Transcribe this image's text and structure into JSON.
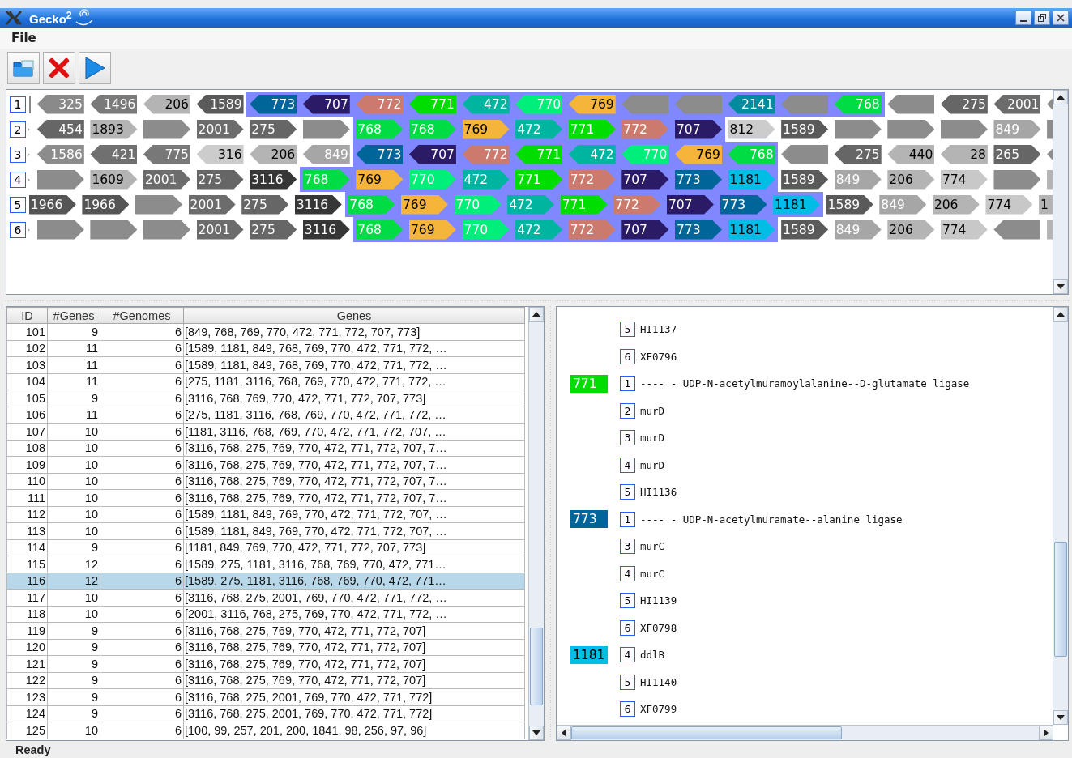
{
  "window": {
    "title": "Gecko$^{2}$"
  },
  "menu": [
    "File"
  ],
  "gene_rows": [
    {
      "number": "1",
      "kind": "bar",
      "genes": [
        {
          "label": "325",
          "color": "#8a8a8a",
          "dark_label": false,
          "kind": "reverse",
          "highlighted": false
        },
        {
          "label": "1496",
          "color": "#7a7a7a",
          "dark_label": false,
          "kind": "reverse",
          "highlighted": false
        },
        {
          "label": "206",
          "color": "#b4b4b4",
          "dark_label": true,
          "kind": "reverse",
          "highlighted": false
        },
        {
          "label": "1589",
          "color": "#5a5a5a",
          "dark_label": false,
          "kind": "reverse",
          "highlighted": false
        },
        {
          "label": "773",
          "color": "#006699",
          "dark_label": false,
          "kind": "reverse",
          "highlighted": true
        },
        {
          "label": "707",
          "color": "#2b1a66",
          "dark_label": false,
          "kind": "reverse",
          "highlighted": true
        },
        {
          "label": "772",
          "color": "#cc7a6e",
          "dark_label": false,
          "kind": "reverse",
          "highlighted": true
        },
        {
          "label": "771",
          "color": "#00dd00",
          "dark_label": false,
          "kind": "reverse",
          "highlighted": true
        },
        {
          "label": "472",
          "color": "#00b5a0",
          "dark_label": false,
          "kind": "reverse",
          "highlighted": true
        },
        {
          "label": "770",
          "color": "#00ee7a",
          "dark_label": false,
          "kind": "reverse",
          "highlighted": true
        },
        {
          "label": "769",
          "color": "#f5b53a",
          "dark_label": true,
          "kind": "reverse",
          "highlighted": true
        },
        {
          "color": "#8c8c8c",
          "kind": "reverse",
          "highlighted": true
        },
        {
          "color": "#8c8c8c",
          "kind": "reverse",
          "highlighted": true
        },
        {
          "label": "2141",
          "color": "#008b9e",
          "dark_label": false,
          "kind": "reverse",
          "highlighted": true
        },
        {
          "color": "#8c8c8c",
          "kind": "reverse",
          "highlighted": true
        },
        {
          "label": "768",
          "color": "#00dd44",
          "dark_label": false,
          "kind": "reverse",
          "highlighted": true
        },
        {
          "color": "#8c8c8c",
          "kind": "reverse",
          "highlighted": false
        },
        {
          "label": "275",
          "color": "#666666",
          "dark_label": false,
          "kind": "reverse",
          "highlighted": false
        },
        {
          "label": "2001",
          "color": "#6c6c6c",
          "dark_label": false,
          "kind": "reverse",
          "highlighted": false
        },
        {
          "color": "#8c8c8c",
          "kind": "reverse",
          "highlighted": false
        }
      ]
    },
    {
      "number": "2",
      "kind": "dot",
      "genes": [
        {
          "label": "454",
          "color": "#666666",
          "dark_label": false,
          "kind": "reverse",
          "highlighted": false
        },
        {
          "label": "1893",
          "color": "#b4b4b4",
          "dark_label": true,
          "kind": "forward",
          "highlighted": false
        },
        {
          "color": "#8c8c8c",
          "kind": "forward",
          "highlighted": false
        },
        {
          "label": "2001",
          "color": "#6c6c6c",
          "dark_label": false,
          "kind": "forward",
          "highlighted": false
        },
        {
          "label": "275",
          "color": "#666666",
          "dark_label": false,
          "kind": "forward",
          "highlighted": false
        },
        {
          "color": "#8c8c8c",
          "kind": "forward",
          "highlighted": false
        },
        {
          "label": "768",
          "color": "#00dd44",
          "dark_label": false,
          "kind": "forward",
          "highlighted": true
        },
        {
          "label": "768",
          "color": "#00dd44",
          "dark_label": false,
          "kind": "forward",
          "highlighted": true
        },
        {
          "label": "769",
          "color": "#f5b53a",
          "dark_label": true,
          "kind": "forward",
          "highlighted": true
        },
        {
          "label": "472",
          "color": "#00b5a0",
          "dark_label": false,
          "kind": "forward",
          "highlighted": true
        },
        {
          "label": "771",
          "color": "#00dd00",
          "dark_label": false,
          "kind": "forward",
          "highlighted": true
        },
        {
          "label": "772",
          "color": "#cc7a6e",
          "dark_label": false,
          "kind": "forward",
          "highlighted": true
        },
        {
          "label": "707",
          "color": "#2b1a66",
          "dark_label": false,
          "kind": "forward",
          "highlighted": true
        },
        {
          "label": "812",
          "color": "#cccccc",
          "dark_label": true,
          "kind": "forward",
          "highlighted": false
        },
        {
          "label": "1589",
          "color": "#5a5a5a",
          "dark_label": false,
          "kind": "forward",
          "highlighted": false
        },
        {
          "color": "#8c8c8c",
          "kind": "forward",
          "highlighted": false
        },
        {
          "color": "#8c8c8c",
          "kind": "forward",
          "highlighted": false
        },
        {
          "color": "#8c8c8c",
          "kind": "forward",
          "highlighted": false
        },
        {
          "label": "849",
          "color": "#a6a6a6",
          "dark_label": false,
          "kind": "forward",
          "highlighted": false
        },
        {
          "color": "#8c8c8c",
          "kind": "forward",
          "highlighted": false
        }
      ]
    },
    {
      "number": "3",
      "kind": "dot",
      "genes": [
        {
          "label": "1586",
          "color": "#8c8c8c",
          "dark_label": false,
          "kind": "reverse",
          "highlighted": false
        },
        {
          "label": "421",
          "color": "#707070",
          "dark_label": false,
          "kind": "reverse",
          "highlighted": false
        },
        {
          "label": "775",
          "color": "#787878",
          "dark_label": false,
          "kind": "reverse",
          "highlighted": false
        },
        {
          "label": "316",
          "color": "#cccccc",
          "dark_label": true,
          "kind": "reverse",
          "highlighted": false
        },
        {
          "label": "206",
          "color": "#b4b4b4",
          "dark_label": true,
          "kind": "reverse",
          "highlighted": false
        },
        {
          "label": "849",
          "color": "#a6a6a6",
          "dark_label": false,
          "kind": "reverse",
          "highlighted": false
        },
        {
          "label": "773",
          "color": "#006699",
          "dark_label": false,
          "kind": "reverse",
          "highlighted": true
        },
        {
          "label": "707",
          "color": "#2b1a66",
          "dark_label": false,
          "kind": "reverse",
          "highlighted": true
        },
        {
          "label": "772",
          "color": "#cc7a6e",
          "dark_label": false,
          "kind": "reverse",
          "highlighted": true
        },
        {
          "label": "771",
          "color": "#00dd00",
          "dark_label": false,
          "kind": "reverse",
          "highlighted": true
        },
        {
          "label": "472",
          "color": "#00b5a0",
          "dark_label": false,
          "kind": "reverse",
          "highlighted": true
        },
        {
          "label": "770",
          "color": "#00ee7a",
          "dark_label": false,
          "kind": "reverse",
          "highlighted": true
        },
        {
          "label": "769",
          "color": "#f5b53a",
          "dark_label": true,
          "kind": "reverse",
          "highlighted": true
        },
        {
          "label": "768",
          "color": "#00dd44",
          "dark_label": false,
          "kind": "reverse",
          "highlighted": true
        },
        {
          "color": "#8c8c8c",
          "kind": "reverse",
          "highlighted": false
        },
        {
          "label": "275",
          "color": "#666666",
          "dark_label": false,
          "kind": "reverse",
          "highlighted": false
        },
        {
          "label": "440",
          "color": "#b4b4b4",
          "dark_label": true,
          "kind": "reverse",
          "highlighted": false
        },
        {
          "label": "28",
          "color": "#b4b4b4",
          "dark_label": true,
          "kind": "reverse",
          "highlighted": false
        },
        {
          "label": "265",
          "color": "#666666",
          "dark_label": false,
          "kind": "forward",
          "highlighted": false
        },
        {
          "color": "#8c8c8c",
          "kind": "reverse",
          "highlighted": false
        }
      ]
    },
    {
      "number": "4",
      "kind": "dot",
      "genes": [
        {
          "color": "#8c8c8c",
          "kind": "forward",
          "highlighted": false
        },
        {
          "label": "1609",
          "color": "#b4b4b4",
          "dark_label": true,
          "kind": "forward",
          "highlighted": false
        },
        {
          "label": "2001",
          "color": "#6c6c6c",
          "dark_label": false,
          "kind": "forward",
          "highlighted": false
        },
        {
          "label": "275",
          "color": "#666666",
          "dark_label": false,
          "kind": "forward",
          "highlighted": false
        },
        {
          "label": "3116",
          "color": "#363636",
          "dark_label": false,
          "kind": "forward",
          "highlighted": false
        },
        {
          "label": "768",
          "color": "#00dd44",
          "dark_label": false,
          "kind": "forward",
          "highlighted": true
        },
        {
          "label": "769",
          "color": "#f5b53a",
          "dark_label": true,
          "kind": "forward",
          "highlighted": true
        },
        {
          "label": "770",
          "color": "#00ee7a",
          "dark_label": false,
          "kind": "forward",
          "highlighted": true
        },
        {
          "label": "472",
          "color": "#00b5a0",
          "dark_label": false,
          "kind": "forward",
          "highlighted": true
        },
        {
          "label": "771",
          "color": "#00dd00",
          "dark_label": false,
          "kind": "forward",
          "highlighted": true
        },
        {
          "label": "772",
          "color": "#cc7a6e",
          "dark_label": false,
          "kind": "forward",
          "highlighted": true
        },
        {
          "label": "707",
          "color": "#2b1a66",
          "dark_label": false,
          "kind": "forward",
          "highlighted": true
        },
        {
          "label": "773",
          "color": "#006699",
          "dark_label": false,
          "kind": "forward",
          "highlighted": true
        },
        {
          "label": "1181",
          "color": "#00bde6",
          "dark_label": true,
          "kind": "forward",
          "highlighted": true
        },
        {
          "label": "1589",
          "color": "#5a5a5a",
          "dark_label": false,
          "kind": "forward",
          "highlighted": false
        },
        {
          "label": "849",
          "color": "#a6a6a6",
          "dark_label": false,
          "kind": "forward",
          "highlighted": false
        },
        {
          "label": "206",
          "color": "#b4b4b4",
          "dark_label": true,
          "kind": "forward",
          "highlighted": false
        },
        {
          "label": "774",
          "color": "#c8c8c8",
          "dark_label": true,
          "kind": "forward",
          "highlighted": false
        },
        {
          "color": "#8c8c8c",
          "kind": "forward",
          "highlighted": false
        },
        {
          "color": "#b4b4b4",
          "kind": "forward",
          "highlighted": false
        }
      ]
    },
    {
      "number": "5",
      "kind": "none",
      "genes": [
        {
          "label": "1966",
          "color": "#555555",
          "dark_label": false,
          "kind": "forward",
          "highlighted": false
        },
        {
          "label": "1966",
          "color": "#555555",
          "dark_label": false,
          "kind": "forward",
          "highlighted": false
        },
        {
          "color": "#8c8c8c",
          "kind": "forward",
          "highlighted": false
        },
        {
          "label": "2001",
          "color": "#6c6c6c",
          "dark_label": false,
          "kind": "forward",
          "highlighted": false
        },
        {
          "label": "275",
          "color": "#666666",
          "dark_label": false,
          "kind": "forward",
          "highlighted": false
        },
        {
          "label": "3116",
          "color": "#363636",
          "dark_label": false,
          "kind": "forward",
          "highlighted": false
        },
        {
          "label": "768",
          "color": "#00dd44",
          "dark_label": false,
          "kind": "forward",
          "highlighted": true
        },
        {
          "label": "769",
          "color": "#f5b53a",
          "dark_label": true,
          "kind": "forward",
          "highlighted": true
        },
        {
          "label": "770",
          "color": "#00ee7a",
          "dark_label": false,
          "kind": "forward",
          "highlighted": true
        },
        {
          "label": "472",
          "color": "#00b5a0",
          "dark_label": false,
          "kind": "forward",
          "highlighted": true
        },
        {
          "label": "771",
          "color": "#00dd00",
          "dark_label": false,
          "kind": "forward",
          "highlighted": true
        },
        {
          "label": "772",
          "color": "#cc7a6e",
          "dark_label": false,
          "kind": "forward",
          "highlighted": true
        },
        {
          "label": "707",
          "color": "#2b1a66",
          "dark_label": false,
          "kind": "forward",
          "highlighted": true
        },
        {
          "label": "773",
          "color": "#006699",
          "dark_label": false,
          "kind": "forward",
          "highlighted": true
        },
        {
          "label": "1181",
          "color": "#00bde6",
          "dark_label": true,
          "kind": "forward",
          "highlighted": true
        },
        {
          "label": "1589",
          "color": "#5a5a5a",
          "dark_label": false,
          "kind": "forward",
          "highlighted": false
        },
        {
          "label": "849",
          "color": "#a6a6a6",
          "dark_label": false,
          "kind": "forward",
          "highlighted": false
        },
        {
          "label": "206",
          "color": "#b4b4b4",
          "dark_label": true,
          "kind": "forward",
          "highlighted": false
        },
        {
          "label": "774",
          "color": "#c8c8c8",
          "dark_label": true,
          "kind": "forward",
          "highlighted": false
        },
        {
          "label": "1",
          "color": "#b4b4b4",
          "dark_label": true,
          "kind": "forward",
          "highlighted": false
        }
      ]
    },
    {
      "number": "6",
      "kind": "dot",
      "genes": [
        {
          "color": "#8c8c8c",
          "kind": "forward",
          "highlighted": false
        },
        {
          "color": "#8c8c8c",
          "kind": "forward",
          "highlighted": false
        },
        {
          "color": "#8c8c8c",
          "kind": "forward",
          "highlighted": false
        },
        {
          "label": "2001",
          "color": "#6c6c6c",
          "dark_label": false,
          "kind": "forward",
          "highlighted": false
        },
        {
          "label": "275",
          "color": "#666666",
          "dark_label": false,
          "kind": "forward",
          "highlighted": false
        },
        {
          "label": "3116",
          "color": "#363636",
          "dark_label": false,
          "kind": "forward",
          "highlighted": false
        },
        {
          "label": "768",
          "color": "#00dd44",
          "dark_label": false,
          "kind": "forward",
          "highlighted": true
        },
        {
          "label": "769",
          "color": "#f5b53a",
          "dark_label": true,
          "kind": "forward",
          "highlighted": true
        },
        {
          "label": "770",
          "color": "#00ee7a",
          "dark_label": false,
          "kind": "forward",
          "highlighted": true
        },
        {
          "label": "472",
          "color": "#00b5a0",
          "dark_label": false,
          "kind": "forward",
          "highlighted": true
        },
        {
          "label": "772",
          "color": "#cc7a6e",
          "dark_label": false,
          "kind": "forward",
          "highlighted": true
        },
        {
          "label": "707",
          "color": "#2b1a66",
          "dark_label": false,
          "kind": "forward",
          "highlighted": true
        },
        {
          "label": "773",
          "color": "#006699",
          "dark_label": false,
          "kind": "forward",
          "highlighted": true
        },
        {
          "label": "1181",
          "color": "#00bde6",
          "dark_label": true,
          "kind": "forward",
          "highlighted": true
        },
        {
          "label": "1589",
          "color": "#5a5a5a",
          "dark_label": false,
          "kind": "forward",
          "highlighted": false
        },
        {
          "label": "849",
          "color": "#a6a6a6",
          "dark_label": false,
          "kind": "forward",
          "highlighted": false
        },
        {
          "label": "206",
          "color": "#b4b4b4",
          "dark_label": true,
          "kind": "forward",
          "highlighted": false
        },
        {
          "label": "774",
          "color": "#c8c8c8",
          "dark_label": true,
          "kind": "forward",
          "highlighted": false
        },
        {
          "color": "#8c8c8c",
          "kind": "reverse",
          "highlighted": false
        },
        {
          "color": "#b4b4b4",
          "kind": "forward",
          "highlighted": false
        }
      ]
    }
  ],
  "table": {
    "columns": [
      "ID",
      "#Genes",
      "#Genomes",
      "Genes"
    ],
    "rows": [
      {
        "cells": [
          "101",
          "9",
          "6",
          "[849, 768, 769, 770, 472, 771, 772, 707, 773]"
        ],
        "selected": false
      },
      {
        "cells": [
          "102",
          "11",
          "6",
          "[1589, 1181, 849, 768, 769, 770, 472, 771, 772, …"
        ],
        "selected": false
      },
      {
        "cells": [
          "103",
          "11",
          "6",
          "[1589, 1181, 849, 768, 769, 770, 472, 771, 772, …"
        ],
        "selected": false
      },
      {
        "cells": [
          "104",
          "11",
          "6",
          "[275, 1181, 3116, 768, 769, 770, 472, 771, 772, …"
        ],
        "selected": false
      },
      {
        "cells": [
          "105",
          "9",
          "6",
          "[3116, 768, 769, 770, 472, 771, 772, 707, 773]"
        ],
        "selected": false
      },
      {
        "cells": [
          "106",
          "11",
          "6",
          "[275, 1181, 3116, 768, 769, 770, 472, 771, 772, …"
        ],
        "selected": false
      },
      {
        "cells": [
          "107",
          "10",
          "6",
          "[1181, 3116, 768, 769, 770, 472, 771, 772, 707, …"
        ],
        "selected": false
      },
      {
        "cells": [
          "108",
          "10",
          "6",
          "[3116, 768, 275, 769, 770, 472, 771, 772, 707, 7…"
        ],
        "selected": false
      },
      {
        "cells": [
          "109",
          "10",
          "6",
          "[3116, 768, 275, 769, 770, 472, 771, 772, 707, 7…"
        ],
        "selected": false
      },
      {
        "cells": [
          "110",
          "10",
          "6",
          "[3116, 768, 275, 769, 770, 472, 771, 772, 707, 7…"
        ],
        "selected": false
      },
      {
        "cells": [
          "111",
          "10",
          "6",
          "[3116, 768, 275, 769, 770, 472, 771, 772, 707, 7…"
        ],
        "selected": false
      },
      {
        "cells": [
          "112",
          "10",
          "6",
          "[1589, 1181, 849, 769, 770, 472, 771, 772, 707, …"
        ],
        "selected": false
      },
      {
        "cells": [
          "113",
          "10",
          "6",
          "[1589, 1181, 849, 769, 770, 472, 771, 772, 707, …"
        ],
        "selected": false
      },
      {
        "cells": [
          "114",
          "9",
          "6",
          "[1181, 849, 769, 770, 472, 771, 772, 707, 773]"
        ],
        "selected": false
      },
      {
        "cells": [
          "115",
          "12",
          "6",
          "[1589, 275, 1181, 3116, 768, 769, 770, 472, 771…"
        ],
        "selected": false
      },
      {
        "cells": [
          "116",
          "12",
          "6",
          "[1589, 275, 1181, 3116, 768, 769, 770, 472, 771…"
        ],
        "selected": true
      },
      {
        "cells": [
          "117",
          "10",
          "6",
          "[3116, 768, 275, 2001, 769, 770, 472, 771, 772, …"
        ],
        "selected": false
      },
      {
        "cells": [
          "118",
          "10",
          "6",
          "[2001, 3116, 768, 275, 769, 770, 472, 771, 772, …"
        ],
        "selected": false
      },
      {
        "cells": [
          "119",
          "9",
          "6",
          "[3116, 768, 275, 769, 770, 472, 771, 772, 707]"
        ],
        "selected": false
      },
      {
        "cells": [
          "120",
          "9",
          "6",
          "[3116, 768, 275, 769, 770, 472, 771, 772, 707]"
        ],
        "selected": false
      },
      {
        "cells": [
          "121",
          "9",
          "6",
          "[3116, 768, 275, 769, 770, 472, 771, 772, 707]"
        ],
        "selected": false
      },
      {
        "cells": [
          "122",
          "9",
          "6",
          "[3116, 768, 275, 769, 770, 472, 771, 772, 707]"
        ],
        "selected": false
      },
      {
        "cells": [
          "123",
          "9",
          "6",
          "[3116, 768, 275, 2001, 769, 770, 472, 771, 772]"
        ],
        "selected": false
      },
      {
        "cells": [
          "124",
          "9",
          "6",
          "[3116, 768, 275, 2001, 769, 770, 472, 771, 772]"
        ],
        "selected": false
      },
      {
        "cells": [
          "125",
          "10",
          "6",
          "[100, 99, 257, 201, 200, 1841, 98, 256, 97, 96]"
        ],
        "selected": false
      }
    ]
  },
  "details": [
    {
      "entries": [
        {
          "genome": "5",
          "text": "HI1137"
        },
        {
          "genome": "6",
          "text": "XF0796"
        }
      ]
    },
    {
      "gene": "771",
      "color": "#00dd00",
      "dark_label": false,
      "entries": [
        {
          "genome": "1",
          "text": "---- - UDP-N-acetylmuramoylalanine--D-glutamate ligase"
        },
        {
          "genome": "2",
          "text": "murD"
        },
        {
          "genome": "3",
          "text": "murD"
        },
        {
          "genome": "4",
          "text": "murD"
        },
        {
          "genome": "5",
          "text": "HI1136"
        }
      ]
    },
    {
      "gene": "773",
      "color": "#006699",
      "dark_label": false,
      "entries": [
        {
          "genome": "1",
          "text": "---- - UDP-N-acetylmuramate--alanine ligase"
        },
        {
          "genome": "3",
          "text": "murC"
        },
        {
          "genome": "4",
          "text": "murC"
        },
        {
          "genome": "5",
          "text": "HI1139"
        },
        {
          "genome": "6",
          "text": "XF0798"
        }
      ]
    },
    {
      "gene": "1181",
      "color": "#00bde6",
      "dark_label": true,
      "entries": [
        {
          "genome": "4",
          "text": "ddlB"
        },
        {
          "genome": "5",
          "text": "HI1140"
        },
        {
          "genome": "6",
          "text": "XF0799"
        }
      ]
    }
  ],
  "status_bar": "Ready"
}
